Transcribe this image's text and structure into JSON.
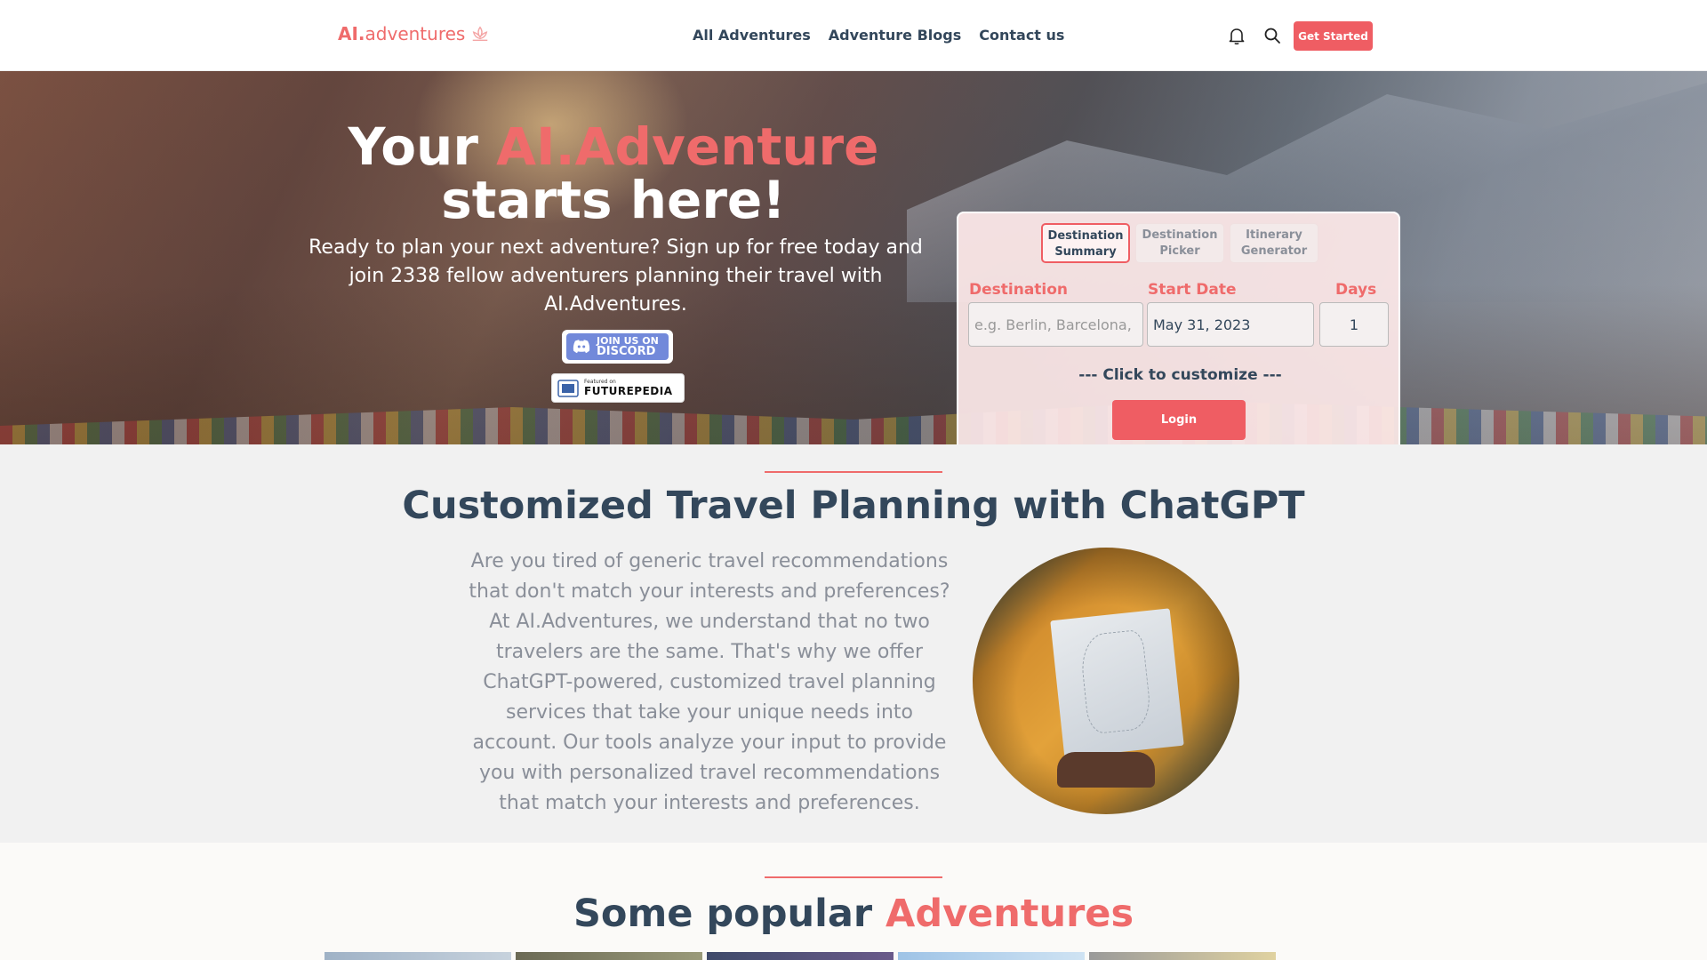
{
  "nav": {
    "logo_prefix": "AI.",
    "logo_suffix": "adventures",
    "links": [
      "All Adventures",
      "Adventure Blogs",
      "Contact us"
    ],
    "get_started": "Get Started"
  },
  "hero": {
    "title_part1": "Your ",
    "title_accent": "AI.Adventure",
    "title_part2": "starts here!",
    "subtitle": "Ready to plan your next adventure? Sign up for free today and join 2338 fellow adventurers planning their travel with AI.Adventures.",
    "discord_line1": "JOIN US ON",
    "discord_line2": "DISCORD",
    "futurepedia_small": "Featured on",
    "futurepedia_big": "FUTUREPEDIA"
  },
  "panel": {
    "tabs": [
      {
        "line1": "Destination",
        "line2": "Summary"
      },
      {
        "line1": "Destination",
        "line2": "Picker"
      },
      {
        "line1": "Itinerary",
        "line2": "Generator"
      }
    ],
    "destination_label": "Destination",
    "destination_placeholder": "e.g. Berlin, Barcelona,",
    "start_date_label": "Start Date",
    "start_date_value": "May 31, 2023",
    "days_label": "Days",
    "days_value": "1",
    "customize": "--- Click to customize ---",
    "login": "Login"
  },
  "section2": {
    "title": "Customized Travel Planning with ChatGPT",
    "text": "Are you tired of generic travel recommendations that don't match your interests and preferences? At AI.Adventures, we understand that no two travelers are the same. That's why we offer ChatGPT-powered, customized travel planning services that take your unique needs into account. Our tools analyze your input to provide you with personalized travel recommendations that match your interests and preferences."
  },
  "section3": {
    "title_part1": "Some popular ",
    "title_accent": "Adventures"
  },
  "colors": {
    "accent": "#ef5d63",
    "heading": "#33475b",
    "muted_text": "#8a8f99"
  },
  "icons": [
    "bell-icon",
    "search-icon",
    "lotus-logo-icon",
    "discord-icon"
  ]
}
